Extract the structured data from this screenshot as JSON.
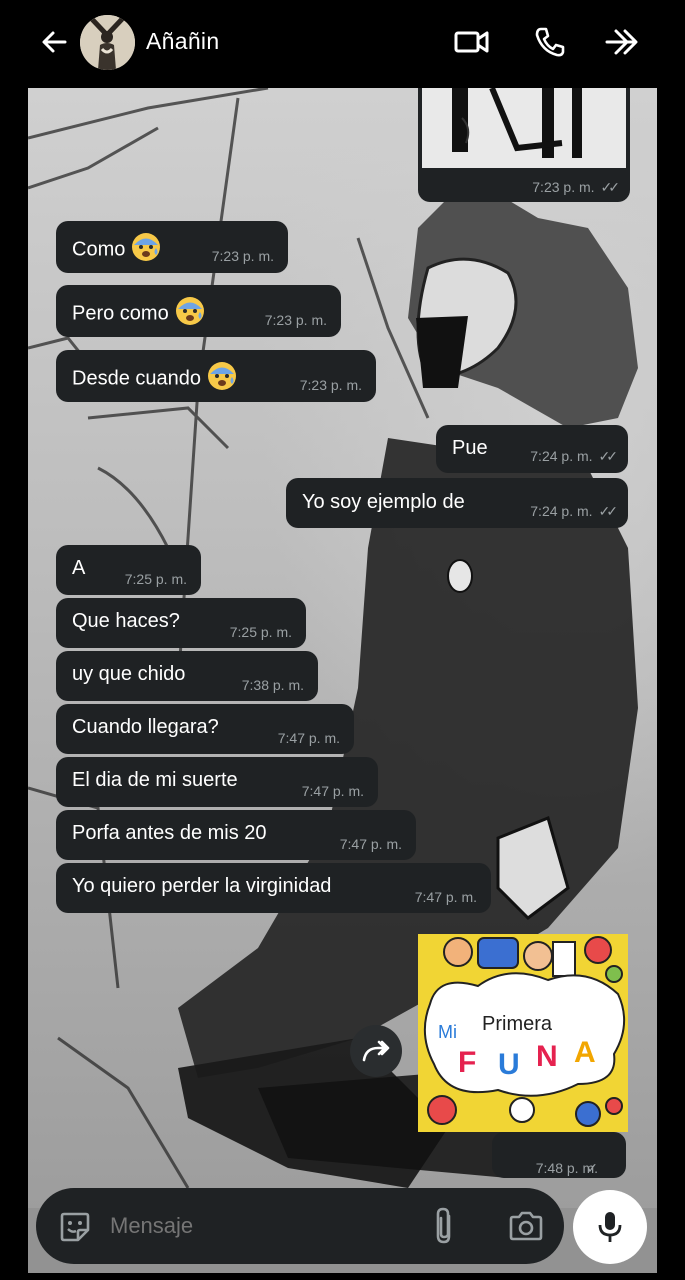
{
  "header": {
    "contact_name": "Añañin",
    "icons": [
      "back-arrow-icon",
      "video-call-icon",
      "phone-call-icon",
      "forward-icon"
    ]
  },
  "messages": [
    {
      "dir": "in",
      "text": "Como",
      "emoji": "anxious-face",
      "time": "7:23 p. m."
    },
    {
      "dir": "in",
      "text": "Pero como",
      "emoji": "anxious-face",
      "time": "7:23 p. m."
    },
    {
      "dir": "in",
      "text": "Desde cuando",
      "emoji": "anxious-face",
      "time": "7:23 p. m."
    },
    {
      "dir": "out",
      "text": "Pue",
      "time": "7:24 p. m.",
      "ticks": "read"
    },
    {
      "dir": "out",
      "text": "Yo soy ejemplo de",
      "time": "7:24 p. m.",
      "ticks": "read"
    },
    {
      "dir": "in",
      "text": "A",
      "time": "7:25 p. m."
    },
    {
      "dir": "in",
      "text": "Que haces?",
      "time": "7:25 p. m."
    },
    {
      "dir": "in",
      "text": "uy que chido",
      "time": "7:38 p. m."
    },
    {
      "dir": "in",
      "text": "Cuando llegara?",
      "time": "7:47 p. m."
    },
    {
      "dir": "in",
      "text": "El dia de mi suerte",
      "time": "7:47 p. m."
    },
    {
      "dir": "in",
      "text": "Porfa antes de mis 20",
      "time": "7:47 p. m."
    },
    {
      "dir": "in",
      "text": "Yo quiero perder la virginidad",
      "time": "7:47 p. m."
    }
  ],
  "image_top": {
    "time": "7:23 p. m.",
    "ticks": "read"
  },
  "sticker": {
    "line1": "Mi",
    "line2": "Primera",
    "letters": [
      "F",
      "U",
      "N",
      "A"
    ],
    "letter_colors": [
      "#e5224f",
      "#2a7bd9",
      "#e5224f",
      "#f2a600"
    ],
    "time": "7:48 p. m.",
    "ticks": "sent"
  },
  "composer": {
    "placeholder": "Mensaje"
  },
  "colors": {
    "bubble": "#1f2224",
    "time_text": "#9aa0a3",
    "header_bg": "#000000"
  }
}
